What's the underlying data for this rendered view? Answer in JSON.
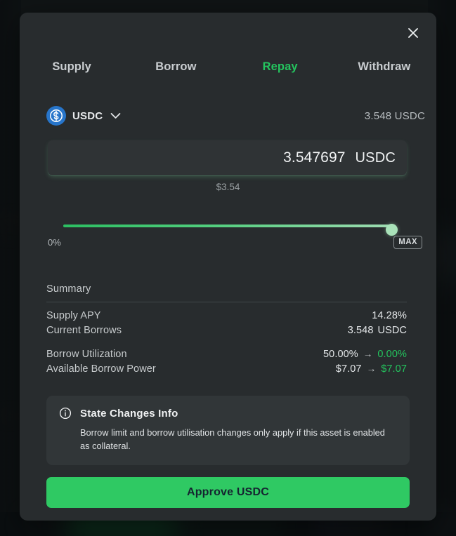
{
  "modal": {
    "close_icon": "close-icon",
    "tabs": [
      {
        "label": "Supply",
        "active": false
      },
      {
        "label": "Borrow",
        "active": false
      },
      {
        "label": "Repay",
        "active": true
      },
      {
        "label": "Withdraw",
        "active": false
      }
    ],
    "token": {
      "icon": "usdc-token-icon",
      "symbol": "USDC",
      "chevron_icon": "chevron-down-icon",
      "wallet_balance": "3.548 USDC"
    },
    "amount": {
      "value": "3.547697",
      "unit": "USDC",
      "fiat": "$3.54"
    },
    "slider": {
      "min_label": "0%",
      "max_label": "MAX",
      "percent": 100
    },
    "summary": {
      "title": "Summary",
      "rows": [
        {
          "label": "Supply APY",
          "value": "14.28%",
          "unit": "",
          "arrow": false,
          "after": ""
        },
        {
          "label": "Current Borrows",
          "value": "3.548",
          "unit": "USDC",
          "arrow": false,
          "after": ""
        },
        {
          "label": "Borrow Utilization",
          "value": "50.00%",
          "unit": "",
          "arrow": true,
          "arrow_glyph": "→",
          "after": "0.00%"
        },
        {
          "label": "Available Borrow Power",
          "value": "$7.07",
          "unit": "",
          "arrow": true,
          "arrow_glyph": "→",
          "after": "$7.07"
        }
      ]
    },
    "info": {
      "icon": "info-circle-icon",
      "title": "State Changes Info",
      "text": "Borrow limit and borrow utilisation changes only apply if this asset is enabled as collateral."
    },
    "action": {
      "label": "Approve USDC"
    }
  },
  "colors": {
    "accent_green": "#24c45e",
    "button_green": "#2fc963",
    "usdc_blue": "#2775ca",
    "modal_bg": "#282c2e",
    "input_bg": "#2f3335",
    "info_bg": "#31363 8"
  }
}
